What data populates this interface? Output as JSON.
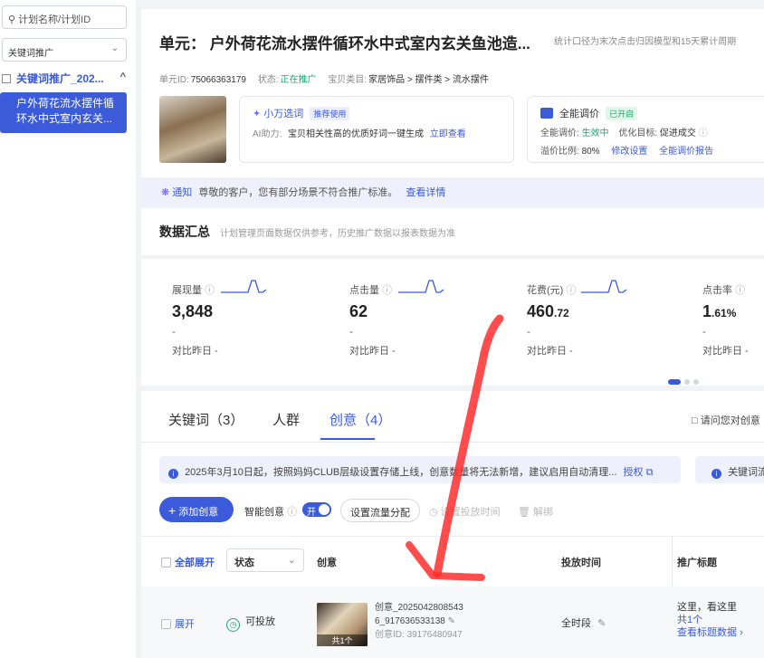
{
  "sidebar": {
    "search_placeholder": "计划名称/计划ID",
    "filter_value": "关键词推广",
    "plan_label": "关键词推广_202...",
    "unit_item": "户外荷花流水摆件循环水中式室内玄关..."
  },
  "header": {
    "unit_title": "单元：  户外荷花流水摆件循环水中式室内玄关鱼池造...",
    "stat_note": "统计口径为末次点击归因模型和15天累计周期",
    "unit_id_label": "单元ID:",
    "unit_id": "75066363179",
    "status_label": "状态:",
    "status": "正在推广",
    "category_label": "宝贝类目:",
    "category": "家居饰品 > 摆件类 > 流水摆件"
  },
  "assist_card": {
    "title": "小万选词",
    "badge": "推荐使用",
    "ai_label": "AI助力:",
    "desc": "宝贝相关性高的优质好词一键生成",
    "link": "立即查看"
  },
  "bid_card": {
    "title": "全能调价",
    "badge": "已开启",
    "bid_label": "全能调价:",
    "bid_status": "生效中",
    "goal_label": "优化目标:",
    "goal": "促进成交",
    "premium_label": "溢价比例:",
    "premium": "80%",
    "edit_link": "修改设置",
    "report_link": "全能调价报告"
  },
  "notice": {
    "tag": "通知",
    "text": "尊敬的客户，您有部分场景不符合推广标准。",
    "link": "查看详情"
  },
  "summary": {
    "title": "数据汇总",
    "subtitle": "计划管理页面数据仅供参考，历史推广数据以报表数据为准",
    "metrics": [
      {
        "label": "展现量",
        "value": "3,848",
        "decimal": "",
        "dash": "-",
        "compare": "对比昨日 -"
      },
      {
        "label": "点击量",
        "value": "62",
        "decimal": "",
        "dash": "-",
        "compare": "对比昨日 -"
      },
      {
        "label": "花费(元)",
        "value": "460",
        "decimal": ".72",
        "dash": "-",
        "compare": "对比昨日 -"
      },
      {
        "label": "点击率",
        "value": "1",
        "decimal": ".61%",
        "dash": "-",
        "compare": "对比昨日 -"
      }
    ]
  },
  "tabs": [
    {
      "label": "关键词（3）"
    },
    {
      "label": "人群"
    },
    {
      "label": "创意（4）"
    }
  ],
  "feedback_link": "请问您对创意",
  "info_bar": {
    "text": "2025年3月10日起，按照妈妈CLUB层级设置存储上线，创意数量将无法新增，建议启用自动清理...",
    "link": "授权",
    "right_text": "关键词流"
  },
  "toolbar": {
    "add_button": "添加创意",
    "smart_label": "智能创意",
    "toggle_label": "开",
    "flow_button": "设置流量分配",
    "schedule_button": "设置投放时间",
    "unbind_button": "解绑"
  },
  "table": {
    "headers": {
      "expand_all": "全部展开",
      "status": "状态",
      "creative": "创意",
      "time": "投放时间",
      "title": "推广标题"
    },
    "row": {
      "expand": "展开",
      "status": "可投放",
      "creative_name_1": "创意_2025042808543",
      "creative_name_2": "6_917636533138",
      "creative_id_label": "创意ID:",
      "creative_id": "39176480947",
      "image_count": "共1个",
      "time": "全时段",
      "title_text": "这里，看这里",
      "title_count": "共1个",
      "title_link": "查看标题数据"
    }
  },
  "colors": {
    "primary": "#3b5bdb",
    "success": "#22a66e",
    "annotation_arrow": "#ff2d2d"
  }
}
